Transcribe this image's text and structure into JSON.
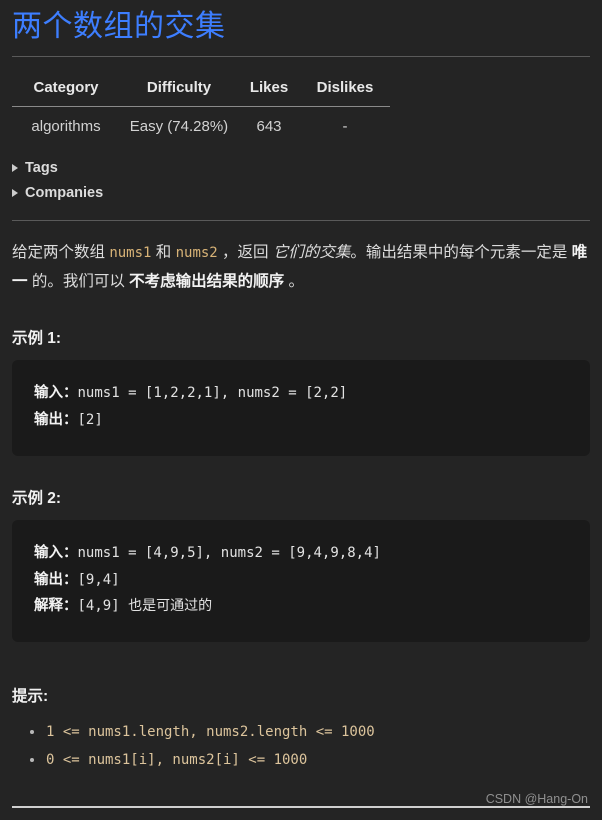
{
  "page": {
    "title": "两个数组的交集",
    "background_color": "#242424",
    "title_color": "#3d7eff",
    "code_background_color": "#1a1a1a",
    "inline_code_color": "#d8b377"
  },
  "meta_table": {
    "headers": [
      "Category",
      "Difficulty",
      "Likes",
      "Dislikes"
    ],
    "rows": [
      [
        "algorithms",
        "Easy (74.28%)",
        "643",
        "-"
      ]
    ]
  },
  "details": [
    {
      "label": "Tags",
      "expanded": false,
      "marker": "triangle-right-icon"
    },
    {
      "label": "Companies",
      "expanded": false,
      "marker": "triangle-right-icon"
    }
  ],
  "description": {
    "parts": [
      {
        "type": "text",
        "value": "给定两个数组 "
      },
      {
        "type": "code",
        "value": "nums1"
      },
      {
        "type": "text",
        "value": " 和 "
      },
      {
        "type": "code",
        "value": "nums2"
      },
      {
        "type": "text",
        "value": " ，返回 "
      },
      {
        "type": "em",
        "value": "它们的交集"
      },
      {
        "type": "text",
        "value": "。输出结果中的每个元素一定是 "
      },
      {
        "type": "strong",
        "value": "唯一"
      },
      {
        "type": "text",
        "value": " 的。我们可以 "
      },
      {
        "type": "strong",
        "value": "不考虑输出结果的顺序"
      },
      {
        "type": "text",
        "value": " 。"
      }
    ],
    "plain": "给定两个数组 nums1 和 nums2 ，返回 它们的交集。输出结果中的每个元素一定是 唯一 的。我们可以 不考虑输出结果的顺序 。"
  },
  "examples": [
    {
      "heading": "示例 1:",
      "lines": [
        {
          "label": "输入：",
          "value": "nums1 = [1,2,2,1], nums2 = [2,2]"
        },
        {
          "label": "输出：",
          "value": "[2]"
        }
      ]
    },
    {
      "heading": "示例 2:",
      "lines": [
        {
          "label": "输入：",
          "value": "nums1 = [4,9,5], nums2 = [9,4,9,8,4]"
        },
        {
          "label": "输出：",
          "value": "[9,4]"
        },
        {
          "label": "解释：",
          "value": "[4,9] 也是可通过的"
        }
      ]
    }
  ],
  "hints": {
    "heading": "提示:",
    "items": [
      "1 <= nums1.length, nums2.length <= 1000",
      "0 <= nums1[i], nums2[i] <= 1000"
    ]
  },
  "watermark": "CSDN @Hang-On"
}
